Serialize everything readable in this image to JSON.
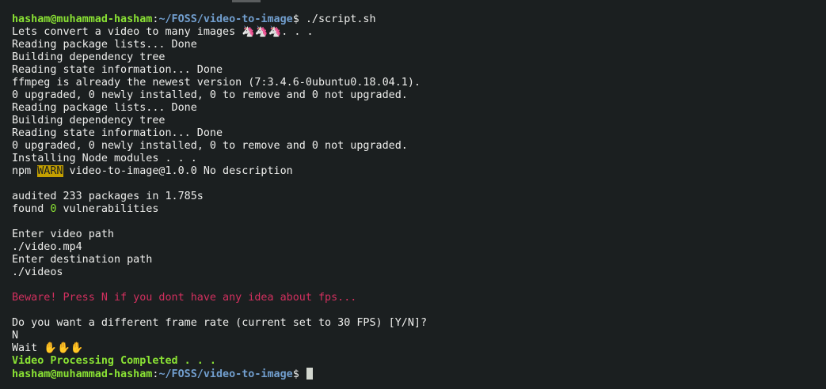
{
  "prompt": {
    "user_host": "hasham@muhammad-hasham",
    "separator": ":",
    "cwd": "~/FOSS/video-to-image",
    "symbol": "$"
  },
  "command": " ./script.sh",
  "lines": {
    "l01": "Lets convert a video to many images ",
    "l01_emoji": "🦄🦄🦄",
    "l01_tail": ". . .",
    "l02": "Reading package lists... Done",
    "l03": "Building dependency tree",
    "l04": "Reading state information... Done",
    "l05": "ffmpeg is already the newest version (7:3.4.6-0ubuntu0.18.04.1).",
    "l06": "0 upgraded, 0 newly installed, 0 to remove and 0 not upgraded.",
    "l07": "Reading package lists... Done",
    "l08": "Building dependency tree",
    "l09": "Reading state information... Done",
    "l10": "0 upgraded, 0 newly installed, 0 to remove and 0 not upgraded.",
    "l11": "Installing Node modules . . .",
    "l12_prefix": "npm ",
    "l12_warn": "WARN",
    "l12_rest": " video-to-image@1.0.0 No description",
    "l13": "audited 233 packages in 1.785s",
    "l14_prefix": "found ",
    "l14_count": "0",
    "l14_rest": " vulnerabilities",
    "l15": "Enter video path",
    "l16": "./video.mp4",
    "l17": "Enter destination path",
    "l18": "./videos",
    "l19": "Beware! Press N if you dont have any idea about fps...",
    "l20": "Do you want a different frame rate (current set to 30 FPS) [Y/N]?",
    "l21": "N",
    "l22": "Wait ",
    "l22_emoji": "✋✋✋",
    "l23": "Video Processing Completed . . ."
  },
  "colors": {
    "background": "#1b1f20",
    "text": "#eeeeec",
    "user": "#8ae234",
    "path": "#729fcf",
    "warn_bg": "#c4a000",
    "warning_text": "#d3305f"
  }
}
